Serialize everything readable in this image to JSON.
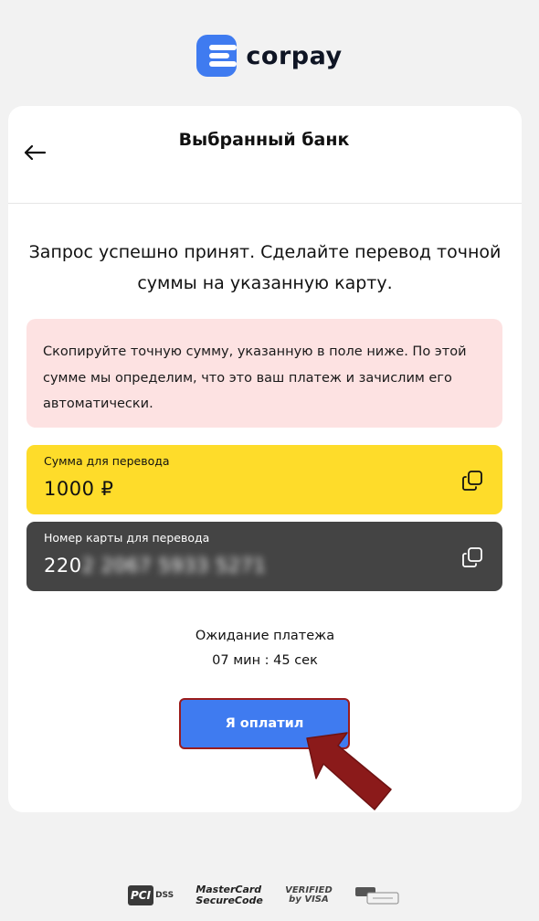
{
  "brand": {
    "name": "corpay"
  },
  "header": {
    "back_icon": "arrow-left-icon",
    "title": "Выбранный банк"
  },
  "headline": "Запрос успешно принят. Сделайте перевод точной суммы на указанную карту.",
  "notice": "Скопируйте точную сумму, указанную в поле ниже. По этой сумме мы определим, что это ваш платеж и зачислим его автоматически.",
  "amount": {
    "label": "Сумма для перевода",
    "value": "1000 ₽",
    "copy_icon": "copy-icon"
  },
  "card_number": {
    "label": "Номер карты для перевода",
    "value_visible": "220",
    "value_blurred": "2 2067 5933 5271",
    "copy_icon": "copy-icon"
  },
  "waiting": {
    "label": "Ожидание платежа",
    "timer": "07 мин : 45 сек"
  },
  "pay_button": {
    "label": "Я оплатил"
  },
  "footer": {
    "pci_label": "PCI",
    "pci_dss": "DSS",
    "mastercard_line1": "MasterCard",
    "mastercard_line2": "SecureCode",
    "visa_line1": "VERIFIED",
    "visa_line2": "by VISA"
  },
  "colors": {
    "accent": "#3f7bf0",
    "notice_bg": "#fde2e2",
    "amount_bg": "#fedc2a",
    "card_bg": "#444444",
    "arrow": "#8b1a1a"
  }
}
